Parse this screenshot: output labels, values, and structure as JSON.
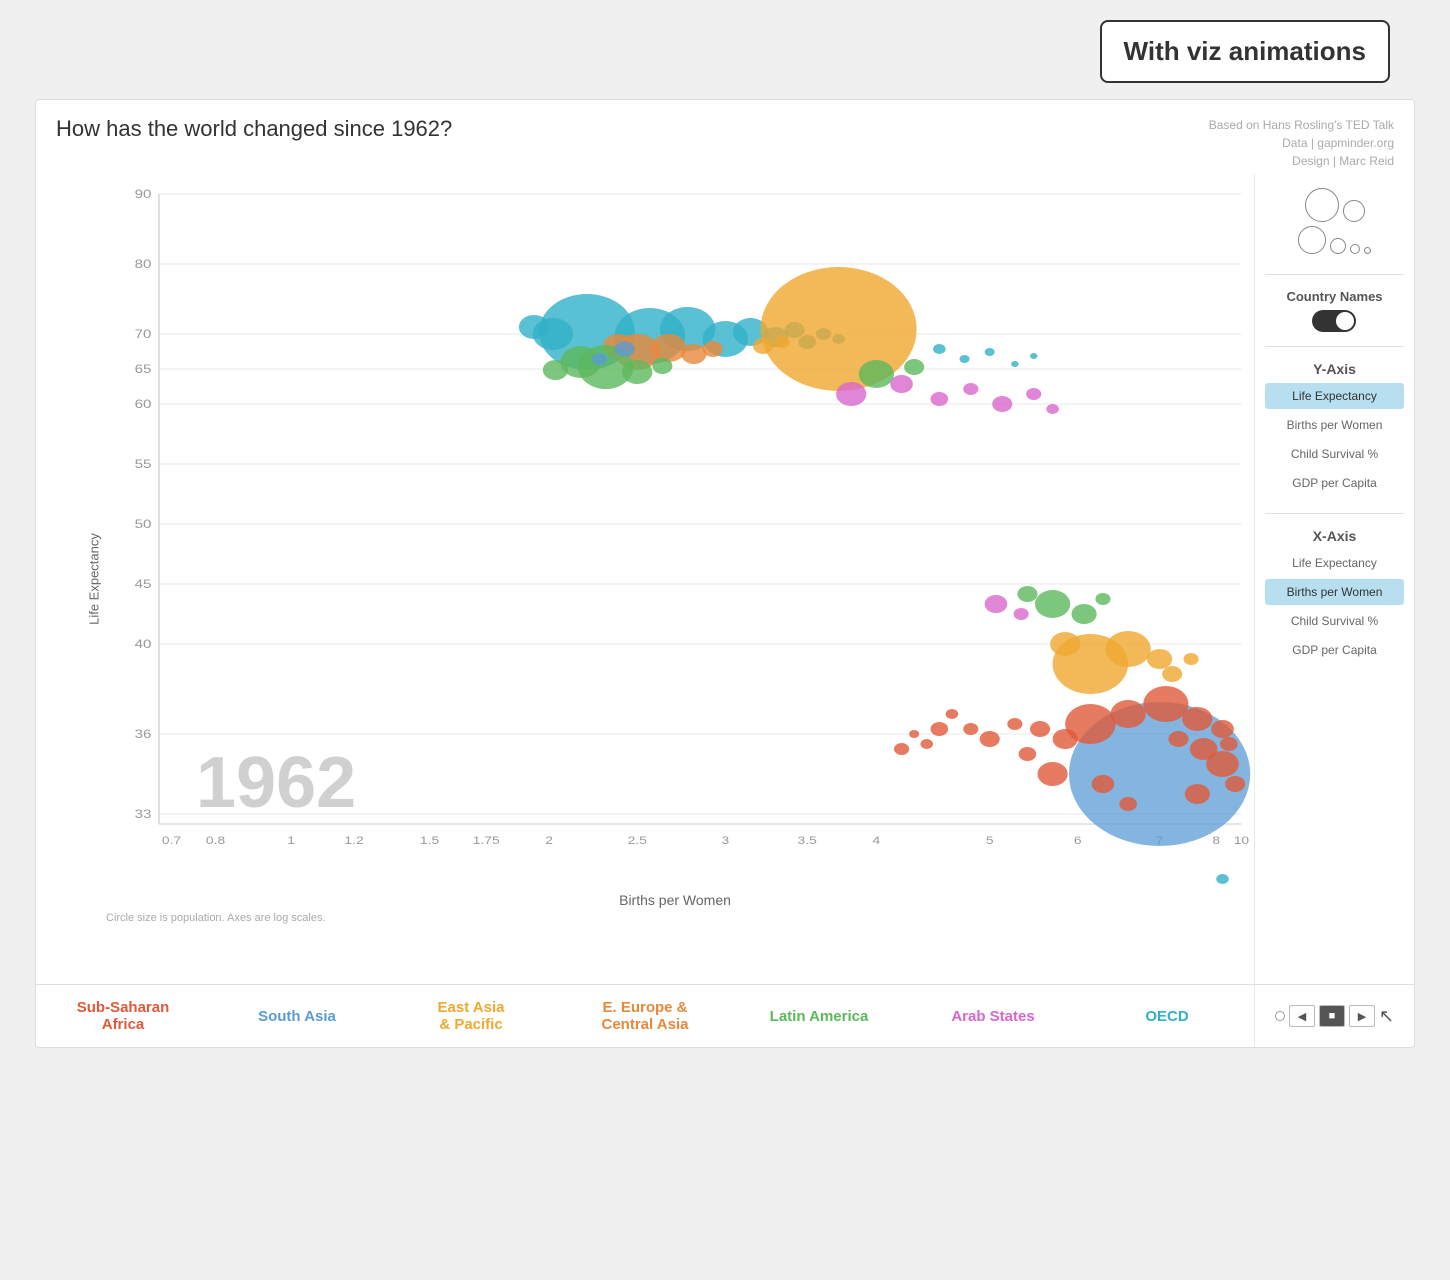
{
  "badge": {
    "text": "With viz animations"
  },
  "header": {
    "title": "How has the world changed since 1962?",
    "attribution_line1": "Based on Hans Rosling's TED Talk",
    "attribution_line2": "Data | gapminder.org",
    "attribution_line3": "Design | Marc Reid"
  },
  "chart": {
    "y_axis_label": "Life Expectancy",
    "x_axis_label": "Births per Women",
    "note": "Circle size is population.  Axes are log scales.",
    "year": "1962",
    "y_ticks": [
      "90",
      "80",
      "70",
      "65",
      "60",
      "55",
      "50",
      "45",
      "40",
      "36",
      "33"
    ],
    "x_ticks": [
      "0.7",
      "0.8",
      "1",
      "1.2",
      "1.5",
      "1.75",
      "2",
      "2.5",
      "3",
      "3.5",
      "4",
      "5",
      "6",
      "7",
      "8",
      "10"
    ]
  },
  "sidebar": {
    "country_names_label": "Country Names",
    "y_axis_title": "Y-Axis",
    "x_axis_title": "X-Axis",
    "y_axis_options": [
      {
        "label": "Life Expectancy",
        "active": true
      },
      {
        "label": "Births per Women",
        "active": false
      },
      {
        "label": "Child Survival %",
        "active": false
      },
      {
        "label": "GDP per Capita",
        "active": false
      }
    ],
    "x_axis_options": [
      {
        "label": "Life Expectancy",
        "active": false
      },
      {
        "label": "Births per Women",
        "active": true
      },
      {
        "label": "Child Survival %",
        "active": false
      },
      {
        "label": "GDP per Capita",
        "active": false
      }
    ]
  },
  "regions": [
    {
      "label": "Sub-Saharan\nAfrica",
      "color": "#e05a3a"
    },
    {
      "label": "South Asia",
      "color": "#5b9bd5"
    },
    {
      "label": "East Asia\n& Pacific",
      "color": "#f0a830"
    },
    {
      "label": "E. Europe &\nCentral Asia",
      "color": "#e8883a"
    },
    {
      "label": "Latin America",
      "color": "#5cb85c"
    },
    {
      "label": "Arab States",
      "color": "#d966cc"
    },
    {
      "label": "OECD",
      "color": "#31b0c8"
    }
  ],
  "controls": {
    "prev_label": "◀",
    "stop_label": "■",
    "next_label": "▶"
  }
}
